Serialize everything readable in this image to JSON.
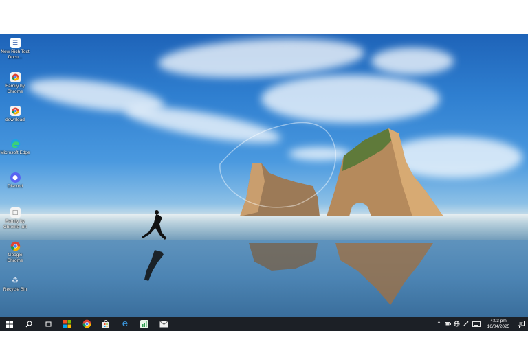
{
  "desktop_icons": [
    {
      "label": "New Rich Text Docu...",
      "icon": "document-icon"
    },
    {
      "label": "Family by Chrome",
      "icon": "chrome-app-icon"
    },
    {
      "label": "download",
      "icon": "chrome-app-icon"
    },
    {
      "label": "Microsoft Edge",
      "icon": "edge-icon"
    },
    {
      "label": "Discord",
      "icon": "discord-icon"
    },
    {
      "label": "Family by Chrome .url",
      "icon": "internet-shortcut-icon"
    },
    {
      "label": "Google Chrome",
      "icon": "chrome-icon"
    },
    {
      "label": "Recycle Bin",
      "icon": "recycle-bin-icon"
    }
  ],
  "taskbar": {
    "pinned": [
      "start-icon",
      "search-icon",
      "task-view-icon",
      "microsoft-store-tiles-icon",
      "chrome-icon",
      "store-bag-icon",
      "edge-icon",
      "sheets-icon",
      "mail-icon"
    ],
    "tray": [
      "chevron-up-icon",
      "battery-icon",
      "globe-icon",
      "pen-icon",
      "keyboard-icon"
    ],
    "time": "4:03 pm",
    "date": "16/04/2025",
    "notification": "notification-icon"
  },
  "colors": {
    "taskbar": "#1c2026",
    "sky": "#2f7fd0"
  }
}
